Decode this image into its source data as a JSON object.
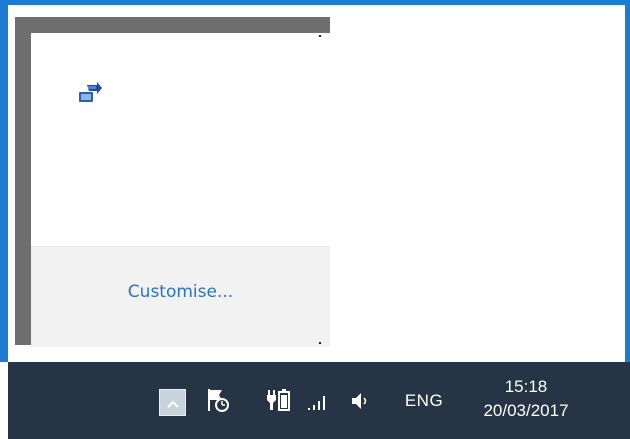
{
  "flyout": {
    "customise_label": "Customise...",
    "icons": [
      {
        "icon": "bluetooth-transfer-app-icon"
      }
    ]
  },
  "taskbar": {
    "tray_icons": [
      {
        "icon": "chevron-up-icon",
        "name": "Show hidden icons"
      },
      {
        "icon": "action-center-flag-icon",
        "name": "Action Center"
      },
      {
        "icon": "battery-power-icon",
        "name": "Power"
      },
      {
        "icon": "network-signal-icon",
        "name": "Network"
      },
      {
        "icon": "speaker-volume-icon",
        "name": "Volume"
      }
    ],
    "language": "ENG",
    "clock": {
      "time": "15:18",
      "date": "20/03/2017"
    }
  },
  "colors": {
    "accent_frame": "#1c7bd3",
    "taskbar_bg": "#263446",
    "flyout_border": "#6e6e6e",
    "link": "#2a73c4"
  }
}
